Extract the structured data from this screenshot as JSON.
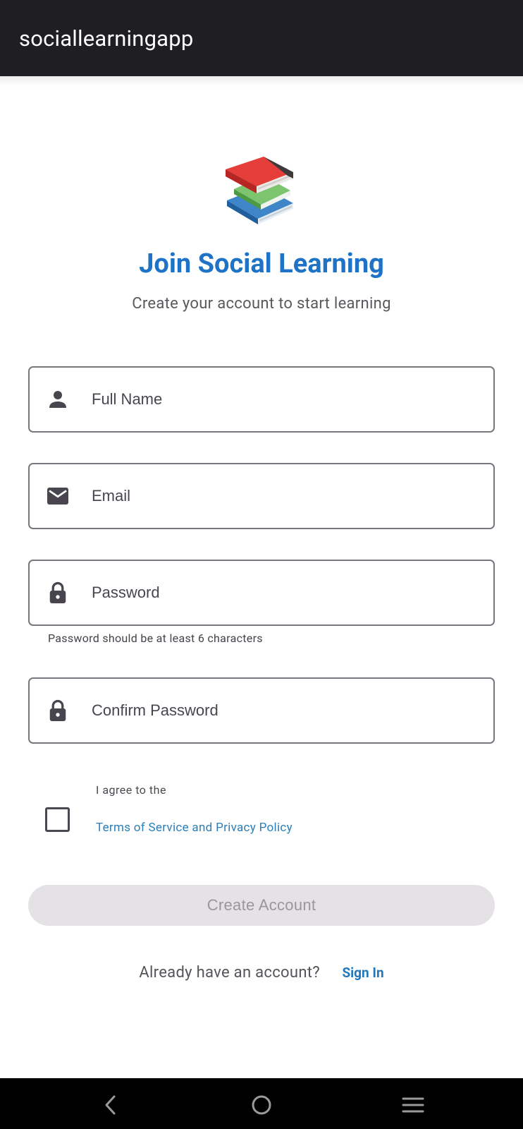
{
  "app": {
    "title": "sociallearningapp"
  },
  "header": {
    "logo_icon": "books-icon",
    "title": "Join Social Learning",
    "subtitle": "Create your account to start learning"
  },
  "form": {
    "full_name": {
      "icon": "person-icon",
      "placeholder": "Full Name",
      "value": ""
    },
    "email": {
      "icon": "mail-icon",
      "placeholder": "Email",
      "value": ""
    },
    "password": {
      "icon": "lock-icon",
      "placeholder": "Password",
      "value": "",
      "helper": "Password should be at least 6 characters"
    },
    "confirm_password": {
      "icon": "lock-icon",
      "placeholder": "Confirm Password",
      "value": ""
    },
    "terms": {
      "checked": false,
      "prefix": "I agree to the",
      "link": "Terms of Service and Privacy Policy"
    },
    "submit": {
      "label": "Create Account",
      "enabled": false
    }
  },
  "footer": {
    "prompt": "Already have an account?",
    "link": "Sign In"
  },
  "system_nav": {
    "back_icon": "back-chevron-icon",
    "home_icon": "home-circle-icon",
    "menu_icon": "menu-lines-icon"
  },
  "colors": {
    "appbar": "#1f1e23",
    "accent": "#1f73c6",
    "link": "#2278b9",
    "field_border": "#79767d",
    "button_disabled_bg": "#e4e2e5",
    "button_disabled_text": "#99969c"
  }
}
